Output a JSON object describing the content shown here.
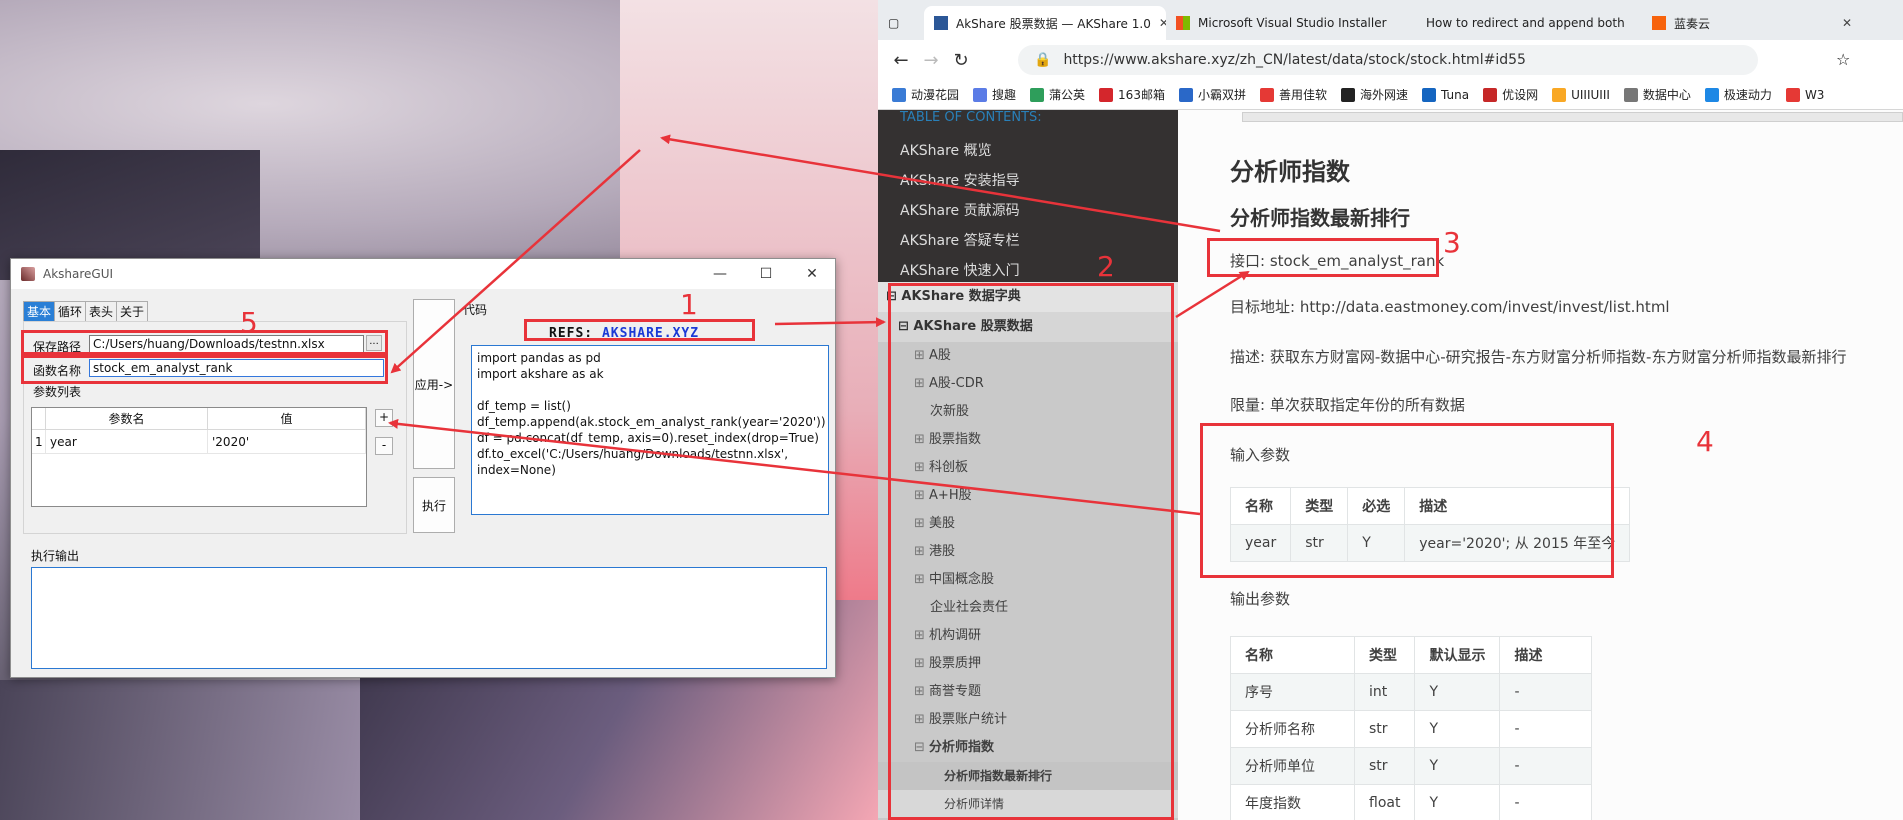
{
  "app": {
    "title": "AkshareGUI",
    "tabs": [
      "基本",
      "循环",
      "表头",
      "关于"
    ],
    "save_path_label": "保存路径",
    "save_path_value": "C:/Users/huang/Downloads/testnn.xlsx",
    "browse_label": "...",
    "func_name_label": "函数名称",
    "func_name_value": "stock_em_analyst_rank",
    "param_list_label": "参数列表",
    "param_table": {
      "headers": [
        "参数名",
        "值"
      ],
      "rows": [
        {
          "index": "1",
          "name": "year",
          "value": "'2020'"
        }
      ]
    },
    "add_label": "+",
    "remove_label": "-",
    "apply_label": "应用->",
    "run_label": "执行",
    "code_label": "代码",
    "refs_prefix": "REFS:",
    "refs_link": "AKSHARE.XYZ",
    "code": "import pandas as pd\nimport akshare as ak\n\ndf_temp = list()\ndf_temp.append(ak.stock_em_analyst_rank(year='2020'))\ndf = pd.concat(df_temp, axis=0).reset_index(drop=True)\ndf.to_excel('C:/Users/huang/Downloads/testnn.xlsx',\nindex=None)",
    "output_label": "执行输出"
  },
  "browser": {
    "tabs": [
      {
        "title": "AkShare 股票数据 — AKShare 1.0",
        "active": true,
        "color": "#2b5797"
      },
      {
        "title": "Microsoft Visual Studio Installer",
        "active": false,
        "color": "#f25022"
      },
      {
        "title": "How to redirect and append both",
        "active": false,
        "color": "#f48024"
      },
      {
        "title": "蓝奏云",
        "active": false,
        "color": "#f7630c"
      }
    ],
    "url": "https://www.akshare.xyz/zh_CN/latest/data/stock/stock.html#id55",
    "bookmarks": [
      {
        "label": "动漫花园",
        "color": "#3a7bd5"
      },
      {
        "label": "搜趣",
        "color": "#5b7ce6"
      },
      {
        "label": "蒲公英",
        "color": "#2e9e5b"
      },
      {
        "label": "163邮箱",
        "color": "#d4262c"
      },
      {
        "label": "小霸双拼",
        "color": "#2a68c8"
      },
      {
        "label": "善用佳软",
        "color": "#e53935"
      },
      {
        "label": "海外网速",
        "color": "#222222"
      },
      {
        "label": "Tuna",
        "color": "#1565c0"
      },
      {
        "label": "优设网",
        "color": "#c62828"
      },
      {
        "label": "UIIIUIII",
        "color": "#f9a825"
      },
      {
        "label": "数据中心",
        "color": "#777777"
      },
      {
        "label": "极速动力",
        "color": "#1e88e5"
      },
      {
        "label": "W3",
        "color": "#e53935"
      }
    ],
    "toc": {
      "header": "TABLE OF CONTENTS:",
      "items": [
        "AKShare 概览",
        "AKShare 安装指导",
        "AKShare 贡献源码",
        "AKShare 答疑专栏",
        "AKShare 快速入门"
      ],
      "section": "AKShare 数据字典",
      "subsection": "AKShare 股票数据",
      "sub_items": [
        "A股",
        "A股-CDR",
        "次新股",
        "股票指数",
        "科创板",
        "A+H股",
        "美股",
        "港股",
        "中国概念股",
        "企业社会责任",
        "机构调研",
        "股票质押",
        "商誉专题",
        "股票账户统计",
        "分析师指数"
      ],
      "children": [
        "分析师指数最新排行",
        "分析师详情"
      ]
    },
    "content": {
      "h1": "分析师指数",
      "h2": "分析师指数最新排行",
      "interface": "接口: stock_em_analyst_rank",
      "target": "目标地址: http://data.eastmoney.com/invest/invest/list.html",
      "desc": "描述: 获取东方财富网-数据中心-研究报告-东方财富分析师指数-东方财富分析师指数最新排行",
      "limit": "限量: 单次获取指定年份的所有数据",
      "input_title": "输入参数",
      "input_headers": [
        "名称",
        "类型",
        "必选",
        "描述"
      ],
      "input_rows": [
        [
          "year",
          "str",
          "Y",
          "year='2020'; 从 2015 年至今"
        ]
      ],
      "output_title": "输出参数",
      "output_headers": [
        "名称",
        "类型",
        "默认显示",
        "描述"
      ],
      "output_rows": [
        [
          "序号",
          "int",
          "Y",
          "-"
        ],
        [
          "分析师名称",
          "str",
          "Y",
          "-"
        ],
        [
          "分析师单位",
          "str",
          "Y",
          "-"
        ],
        [
          "年度指数",
          "float",
          "Y",
          "-"
        ]
      ]
    }
  },
  "annotations": [
    "1",
    "2",
    "3",
    "4",
    "5"
  ],
  "annotation_color": "#e8333a"
}
